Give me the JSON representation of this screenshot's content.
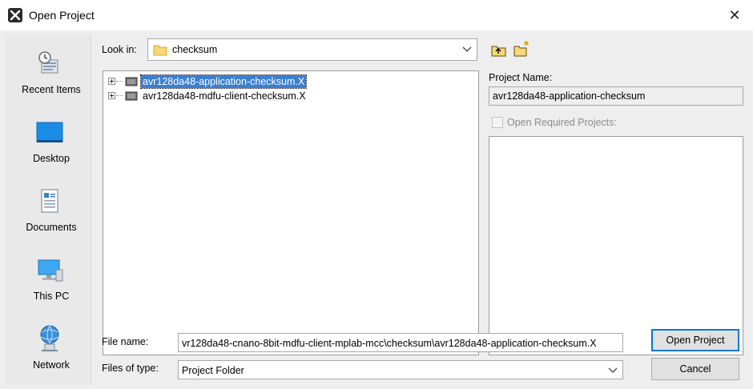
{
  "window": {
    "title": "Open Project",
    "close_glyph": "✕"
  },
  "places": [
    {
      "label": "Recent Items",
      "icon": "recent-items-icon"
    },
    {
      "label": "Desktop",
      "icon": "desktop-icon"
    },
    {
      "label": "Documents",
      "icon": "documents-icon"
    },
    {
      "label": "This PC",
      "icon": "this-pc-icon"
    },
    {
      "label": "Network",
      "icon": "network-icon"
    }
  ],
  "look_in": {
    "label": "Look in:",
    "value": "checksum"
  },
  "files": [
    {
      "name": "avr128da48-application-checksum.X",
      "selected": true
    },
    {
      "name": "avr128da48-mdfu-client-checksum.X",
      "selected": false
    }
  ],
  "project": {
    "name_label": "Project Name:",
    "name_value": "avr128da48-application-checksum",
    "required_label": "Open Required Projects:"
  },
  "file_name": {
    "label": "File name:",
    "value": "vr128da48-cnano-8bit-mdfu-client-mplab-mcc\\checksum\\avr128da48-application-checksum.X"
  },
  "file_type": {
    "label": "Files of type:",
    "value": "Project Folder"
  },
  "buttons": {
    "open": "Open Project",
    "cancel": "Cancel"
  },
  "colors": {
    "selection": "#3b7fd1",
    "default_button_border": "#0078d7",
    "dialog_bg": "#eeeeee"
  }
}
